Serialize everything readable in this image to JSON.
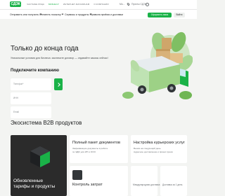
{
  "brand": {
    "logo_text": "СДЭК",
    "color": "#1ab248"
  },
  "top_nav": {
    "items": [
      {
        "label": "ЧАСТНЫЕ ЛИЦА",
        "active": false
      },
      {
        "label": "БИЗНЕСУ",
        "active": true
      },
      {
        "label": "ИНТЕРНЕТ-МАГАЗИНАМ",
        "active": false
      },
      {
        "label": "О КОМПАНИИ",
        "active": false
      }
    ],
    "city_short": "Мо...",
    "track_label": "Пункты СДЭК"
  },
  "main_nav": {
    "items": [
      {
        "label": "Отправить или получить"
      },
      {
        "label": "Оплатить посылку"
      },
      {
        "label": "Сервисы и продукты"
      },
      {
        "label": "Правила приёма и доставки"
      }
    ],
    "order_button": "Оформить заказ",
    "login_button": "Войти"
  },
  "hero": {
    "title": "Только до конца года",
    "subtitle": "Уникальные условия для бизнеса: заключите договор — отдавайте заказы сейчас!",
    "form_heading": "Подключите компанию",
    "phone_placeholder": "Телефон*",
    "inn_placeholder": "ИНН",
    "email_placeholder": "Email"
  },
  "ecosystem": {
    "title": "Экосистема B2B продуктов",
    "dark_card": {
      "label_line1": "Обновленные",
      "label_line2": "тарифы и продукты"
    },
    "cards": [
      {
        "title": "Полный пакет документов",
        "desc1": "Закрывающие документы в работе",
        "desc2": "по ЭДО для ИП и ООО"
      },
      {
        "title": "Настройка курьерских услуг",
        "desc1": "Вызов на следующий день",
        "desc2": "Адресное доставление и прием грузов"
      },
      {
        "title": "Контроль затрат",
        "desc1": "",
        "desc2": ""
      },
      {
        "title": "Международная доставка",
        "desc1": "",
        "desc2": ""
      },
      {
        "title": "Доставка за 1 день",
        "desc1": "",
        "desc2": ""
      }
    ]
  }
}
